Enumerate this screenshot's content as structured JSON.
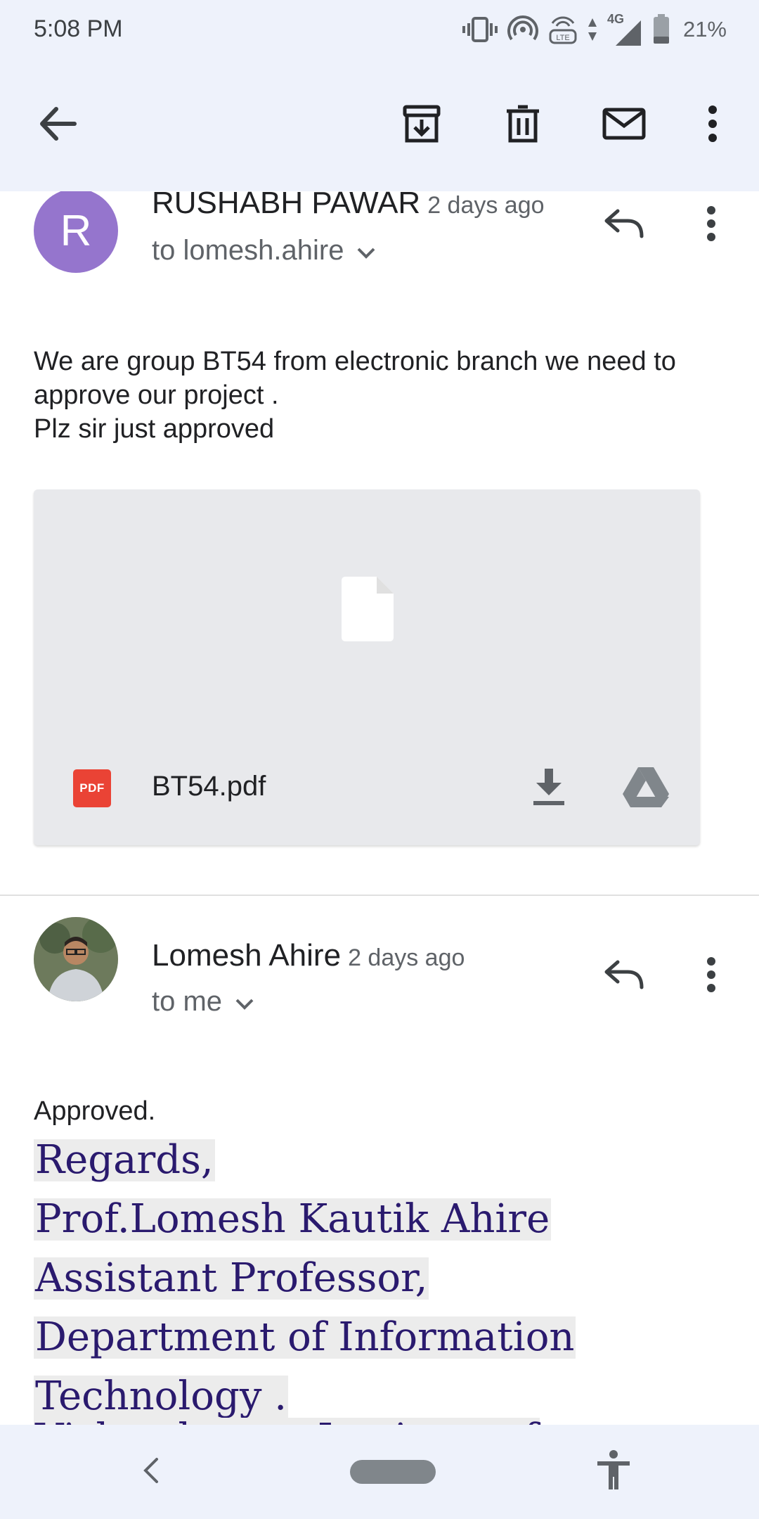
{
  "status_bar": {
    "time": "5:08 PM",
    "network": "4G",
    "lte_label": "LTE",
    "battery": "21%"
  },
  "toolbar": {
    "icons": [
      "back-arrow-icon",
      "archive-icon",
      "delete-icon",
      "mark-unread-icon",
      "more-vert-icon"
    ]
  },
  "messages": [
    {
      "avatar_letter": "R",
      "avatar_color": "#9575cd",
      "sender": "RUSHABH PAWAR",
      "time": "2 days ago",
      "recipient": "to lomesh.ahire",
      "body": [
        "We are group BT54 from electronic branch we need to",
        "approve our project .",
        "Plz sir just approved"
      ],
      "attachment": {
        "type_label": "PDF",
        "filename": "BT54.pdf"
      }
    },
    {
      "sender": "Lomesh Ahire",
      "time": "2 days ago",
      "recipient": "to me",
      "body": [
        "Approved."
      ],
      "signature": [
        "Regards,",
        "Prof.Lomesh Kautik Ahire",
        "Assistant Professor,",
        "Department of Information",
        "Technology .",
        "Vishwakarma Institute of"
      ]
    }
  ],
  "colors": {
    "accent_bar": "#eef2fb",
    "signature_text": "#2a1a6e",
    "pdf_red": "#ea4335"
  }
}
